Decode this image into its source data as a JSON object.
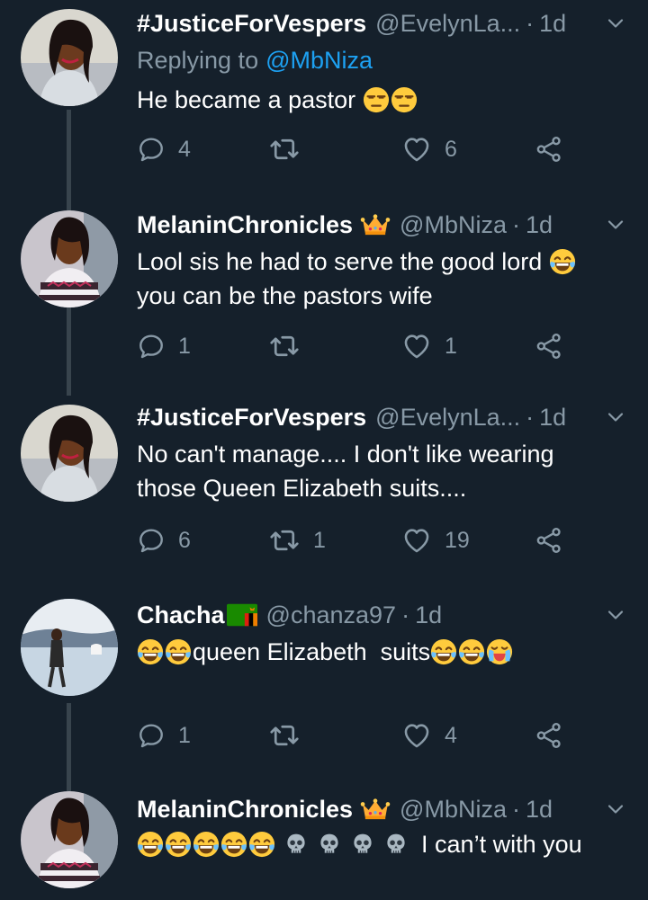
{
  "colors": {
    "background": "#15202b",
    "text": "#ffffff",
    "secondary": "#8899a6",
    "link": "#1da1f2",
    "thread_line": "#38444d"
  },
  "tweets": [
    {
      "display_name": "#JusticeForVespers",
      "handle": "@EvelynLa...",
      "time": "1d",
      "replying_label": "Replying to",
      "replying_to": "@MbNiza",
      "text_lines": [
        "He became a pastor"
      ],
      "emojis": [
        "unamused-face",
        "unamused-face"
      ],
      "replies": "4",
      "retweets": "",
      "likes": "6"
    },
    {
      "display_name": "MelaninChronicles",
      "badge": "crown-emoji",
      "handle": "@MbNiza",
      "time": "1d",
      "text_lines": [
        "Lool sis he had to serve the good lord",
        "you can be the pastors wife"
      ],
      "emojis": [
        "tears-of-joy"
      ],
      "replies": "1",
      "retweets": "",
      "likes": "1"
    },
    {
      "display_name": "#JusticeForVespers",
      "handle": "@EvelynLa...",
      "time": "1d",
      "text_lines": [
        "No can't manage.... I don't like wearing",
        "those Queen Elizabeth suits...."
      ],
      "replies": "6",
      "retweets": "1",
      "likes": "19"
    },
    {
      "display_name": "Chacha",
      "badge": "zambia-flag-emoji",
      "handle": "@chanza97",
      "time": "1d",
      "text_lines": [
        "queen Elizabeth  suits"
      ],
      "emojis": [
        "tears-of-joy",
        "tears-of-joy",
        "tears-of-joy",
        "tears-of-joy",
        "loudly-crying"
      ],
      "replies": "1",
      "retweets": "",
      "likes": "4"
    },
    {
      "display_name": "MelaninChronicles",
      "badge": "crown-emoji",
      "handle": "@MbNiza",
      "time": "1d",
      "text_lines": [
        "I can’t with you"
      ],
      "emojis": [
        "tears-of-joy",
        "tears-of-joy",
        "tears-of-joy",
        "tears-of-joy",
        "tears-of-joy",
        "skull",
        "skull",
        "skull",
        "skull"
      ]
    }
  ],
  "icons": {
    "reply": "reply-icon",
    "retweet": "retweet-icon",
    "like": "heart-icon",
    "share": "share-icon",
    "menu": "chevron-down-icon"
  }
}
